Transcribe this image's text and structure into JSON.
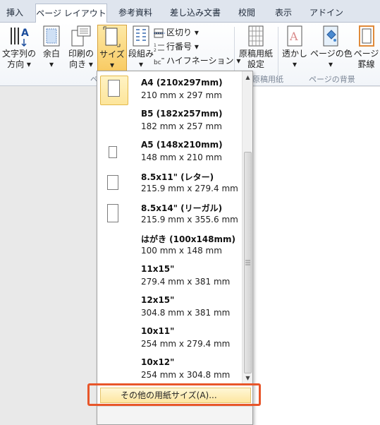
{
  "tabs": [
    {
      "label": "挿入"
    },
    {
      "label": "ページ レイアウト"
    },
    {
      "label": "参考資料"
    },
    {
      "label": "差し込み文書"
    },
    {
      "label": "校閲"
    },
    {
      "label": "表示"
    },
    {
      "label": "アドイン"
    }
  ],
  "ribbon": {
    "text_direction": {
      "line1": "文字列の",
      "line2": "方向 ▾"
    },
    "margins": {
      "line1": "余白",
      "line2": "▾"
    },
    "orientation": {
      "line1": "印刷の",
      "line2": "向き ▾"
    },
    "size": {
      "line1": "サイズ",
      "line2": "▾"
    },
    "columns": {
      "line1": "段組み",
      "line2": "▾"
    },
    "breaks": "区切り ▾",
    "line_numbers": "行番号 ▾",
    "hyphenation": "ハイフネーション ▾",
    "manuscript": {
      "line1": "原稿用紙",
      "line2": "設定"
    },
    "manuscript_group": "原稿用紙",
    "watermark": {
      "line1": "透かし",
      "line2": "▾"
    },
    "page_color": {
      "line1": "ページの色",
      "line2": "▾"
    },
    "page_borders": {
      "line1": "ページ",
      "line2": "罫線"
    },
    "background_group": "ページの背景",
    "page_setup_group_fragment": "ペ"
  },
  "paper_sizes": [
    {
      "name": "A4 (210x297mm)",
      "dims": "210 mm x 297 mm",
      "selected": true
    },
    {
      "name": "B5 (182x257mm)",
      "dims": "182 mm x 257 mm",
      "selected": false
    },
    {
      "name": "A5 (148x210mm)",
      "dims": "148 mm x 210 mm",
      "selected": false
    },
    {
      "name": "8.5x11\" (レター)",
      "dims": "215.9 mm x 279.4 mm",
      "selected": false
    },
    {
      "name": "8.5x14\" (リーガル)",
      "dims": "215.9 mm x 355.6 mm",
      "selected": false
    },
    {
      "name": "はがき (100x148mm)",
      "dims": "100 mm x 148 mm",
      "selected": false
    },
    {
      "name": "11x15\"",
      "dims": "279.4 mm x 381 mm",
      "selected": false
    },
    {
      "name": "12x15\"",
      "dims": "304.8 mm x 381 mm",
      "selected": false
    },
    {
      "name": "10x11\"",
      "dims": "254 mm x 279.4 mm",
      "selected": false
    },
    {
      "name": "10x12\"",
      "dims": "254 mm x 304.8 mm",
      "selected": false
    }
  ],
  "more_sizes_label": "その他の用紙サイズ(A)...",
  "colors": {
    "highlight": "#e8562a",
    "selected_fill": "#fde59a",
    "ribbon_bg": "#f2f5f9"
  }
}
